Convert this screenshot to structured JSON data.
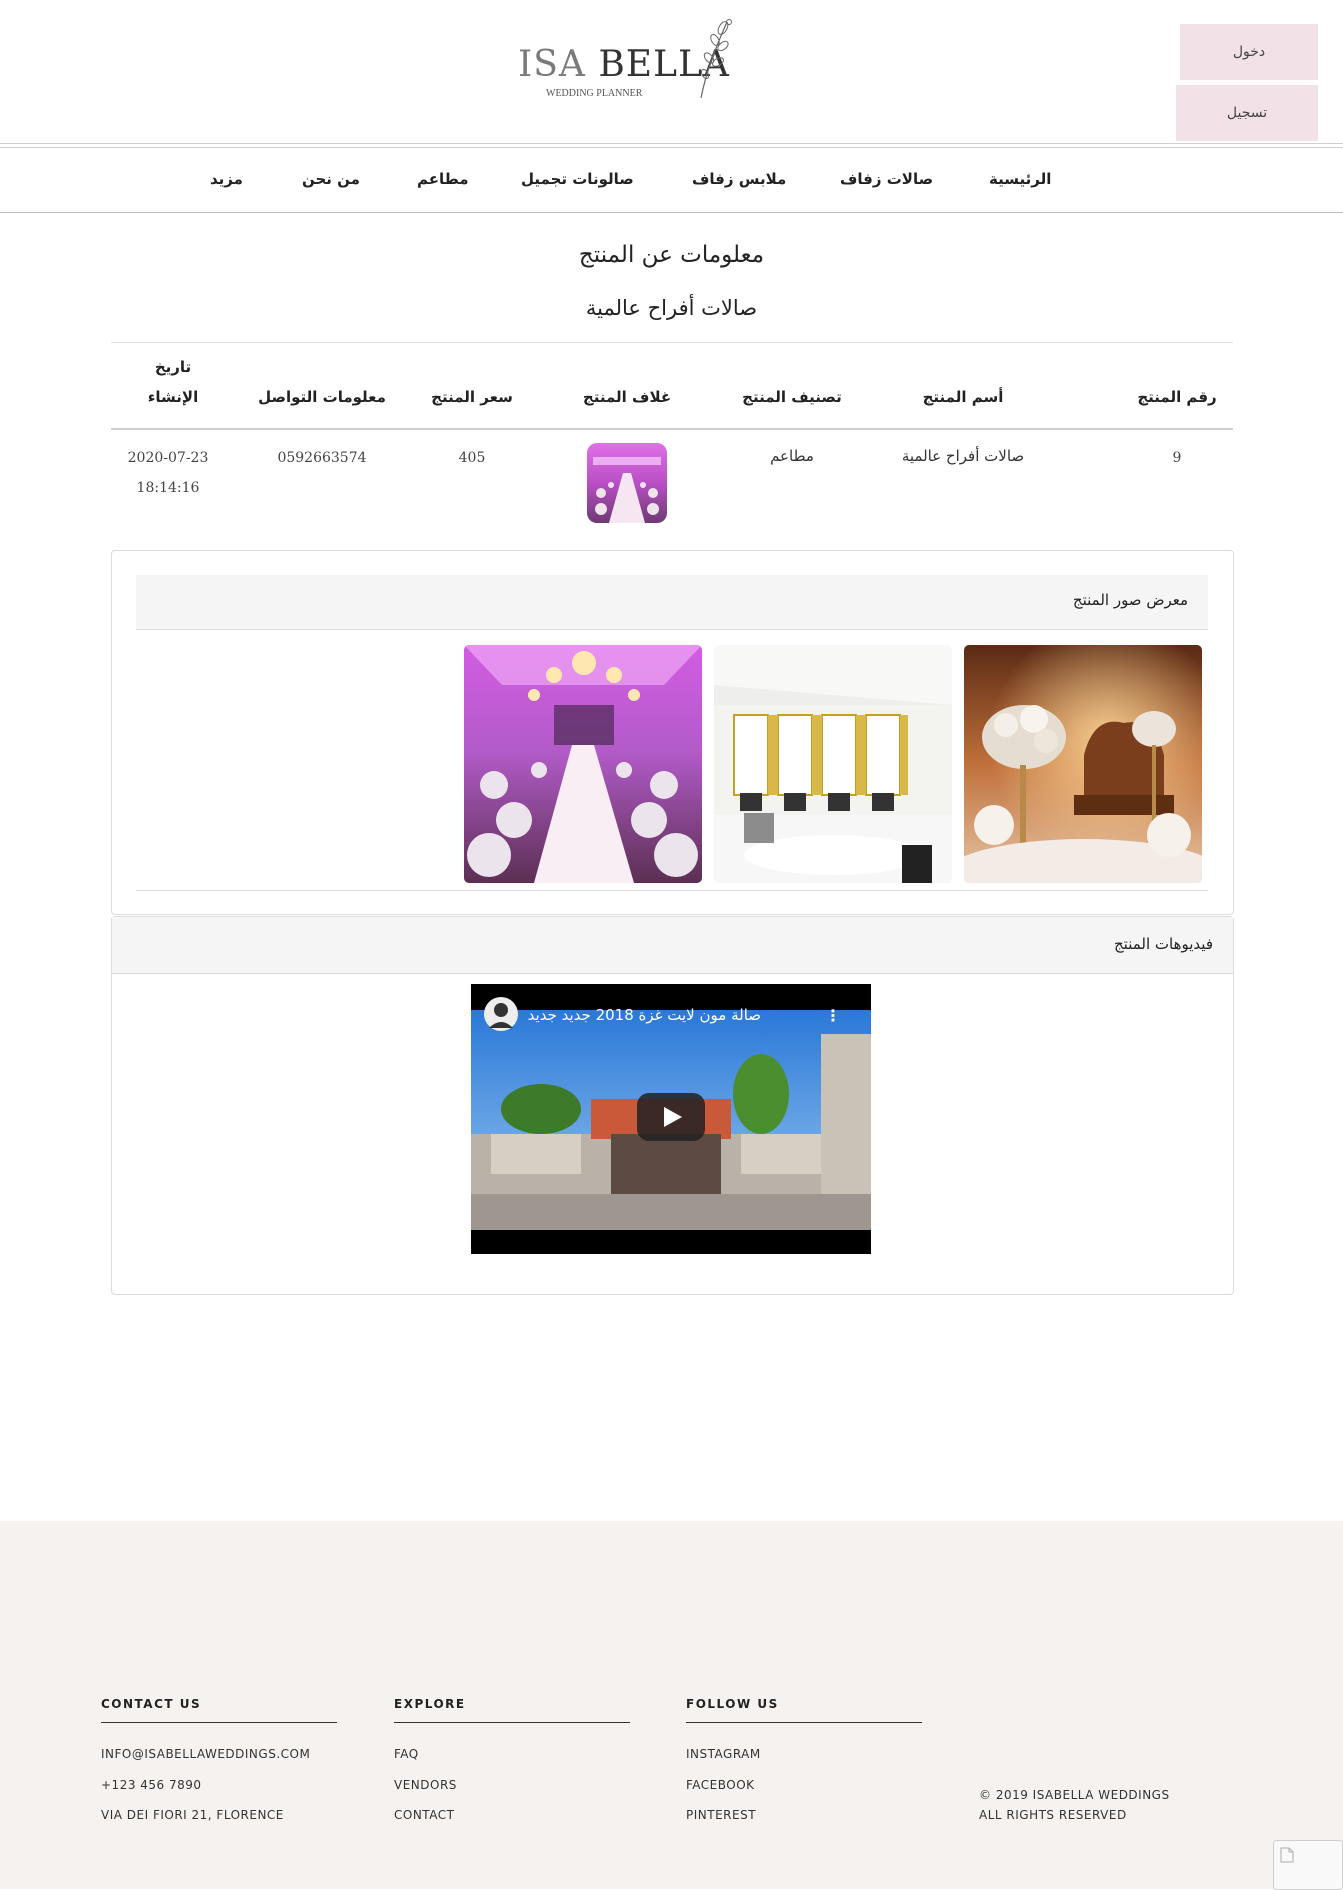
{
  "header": {
    "logo_main_isa": "ISA",
    "logo_main_bella": "BELLA",
    "logo_sub": "WEDDING PLANNER",
    "login_label": "دخول",
    "register_label": "تسجيل"
  },
  "nav": {
    "items": [
      {
        "label": "الرئيسية"
      },
      {
        "label": "صالات زفاف"
      },
      {
        "label": "ملابس زفاف"
      },
      {
        "label": "صالونات تجميل"
      },
      {
        "label": "مطاعم"
      },
      {
        "label": "من نحن"
      },
      {
        "label": "مزيد"
      }
    ]
  },
  "page": {
    "title": "معلومات عن المنتج",
    "product_name": "صالات أفراح عالمية"
  },
  "table": {
    "headers": {
      "id": "رقم المنتج",
      "name": "أسم المنتج",
      "category": "تصنيف المنتج",
      "cover": "غلاف المنتج",
      "price": "سعر المنتج",
      "contact": "معلومات التواصل",
      "created_line1": "تاريخ",
      "created_line2": "الإنشاء"
    },
    "row": {
      "id": "9",
      "name": "صالات أفراح عالمية",
      "category": "مطاعم",
      "price": "405",
      "contact": "0592663574",
      "created_date": "2020-07-23",
      "created_time": "18:14:16"
    }
  },
  "gallery": {
    "title": "معرض صور المنتج"
  },
  "videos": {
    "title": "فيديوهات المنتج",
    "video_title": "صالة مون لايت غزة 2018 جديد جديد"
  },
  "footer": {
    "contact": {
      "title": "CONTACT US",
      "email": "INFO@ISABELLAWEDDINGS.COM",
      "phone": "+123 456 7890",
      "address": "VIA DEI FIORI 21, FLORENCE"
    },
    "explore": {
      "title": "EXPLORE",
      "links": [
        "FAQ",
        "VENDORS",
        "CONTACT"
      ]
    },
    "follow": {
      "title": "FOLLOW US",
      "links": [
        "INSTAGRAM",
        "FACEBOOK",
        "PINTEREST"
      ]
    },
    "copyright_line1": "© 2019 ISABELLA WEDDINGS",
    "copyright_line2": "ALL RIGHTS RESERVED"
  }
}
